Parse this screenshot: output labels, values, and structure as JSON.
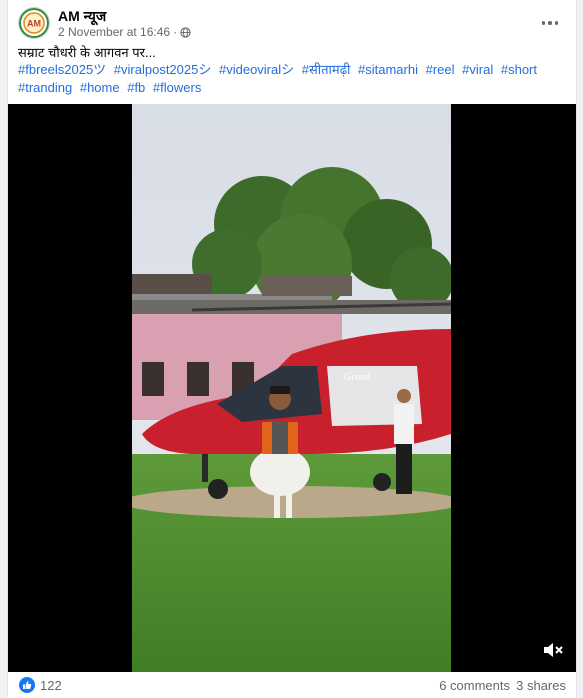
{
  "post": {
    "page_name": "AM न्यूज",
    "timestamp": "2 November at 16:46",
    "separator": "·",
    "audience_icon": "globe-icon",
    "caption": "सम्राट चौधरी के आगवन पर...",
    "hashtags": [
      "#fbreels2025ツ",
      "#viralpost2025シ",
      "#videoviralシ",
      "#सीतामढ़ी",
      "#sitamarhi",
      "#reel",
      "#viral",
      "#short",
      "#tranding",
      "#home",
      "#fb",
      "#flowers"
    ],
    "logo_text": "AM",
    "helicopter_brand": "Grand"
  },
  "footer": {
    "reaction_count": "122",
    "comments": "6 comments",
    "shares": "3 shares"
  },
  "colors": {
    "link": "#216fdb",
    "like": "#1877f2",
    "secondary_text": "#65676b"
  }
}
